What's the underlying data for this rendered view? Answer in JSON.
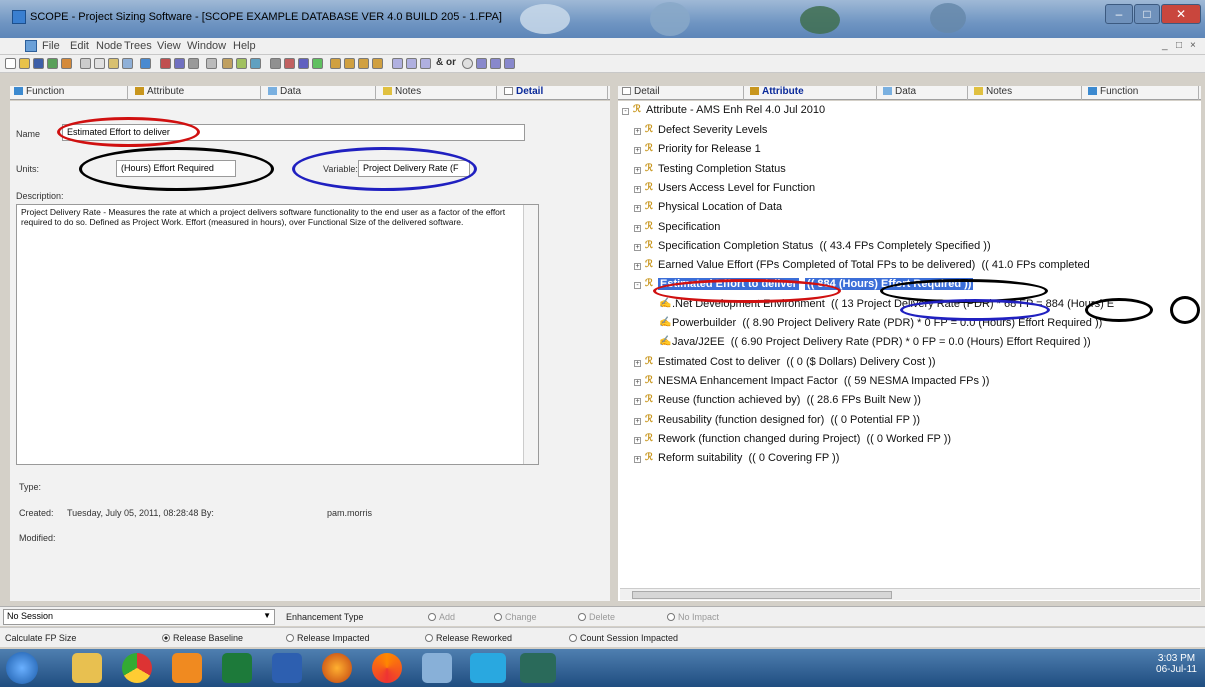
{
  "window": {
    "title": "SCOPE - Project Sizing Software - [SCOPE EXAMPLE DATABASE VER 4.0 BUILD 205 - 1.FPA]"
  },
  "menu": [
    "File",
    "Edit",
    "Node",
    "Trees",
    "View",
    "Window",
    "Help"
  ],
  "toolbar_text": [
    "& or",
    "&"
  ],
  "left_tabs": [
    "Function",
    "Attribute",
    "Data",
    "Notes",
    "Detail"
  ],
  "right_tabs": [
    "Detail",
    "Attribute",
    "Data",
    "Notes",
    "Function"
  ],
  "detail": {
    "name_label": "Name",
    "name_value": "Estimated Effort to deliver",
    "units_label": "Units:",
    "units_value": "(Hours) Effort Required",
    "variable_label": "Variable:",
    "variable_value": "Project Delivery Rate (F",
    "description_label": "Description:",
    "description_value": "Project Delivery Rate - Measures the rate at which a project delivers software functionality to the end user as a factor of the effort required to do so. Defined as Project Work. Effort (measured in hours), over Functional Size of the delivered software.",
    "type_label": "Type:",
    "created_label": "Created:",
    "created_value": "Tuesday, July 05, 2011, 08:28:48 By:",
    "created_by": "pam.morris",
    "modified_label": "Modified:"
  },
  "tree": {
    "root": "Attribute - AMS Enh Rel 4.0 Jul 2010",
    "items": [
      {
        "label": "Defect Severity Levels",
        "value": ""
      },
      {
        "label": "Priority for Release 1",
        "value": ""
      },
      {
        "label": "Testing Completion Status",
        "value": ""
      },
      {
        "label": "Users Access Level for Function",
        "value": ""
      },
      {
        "label": "Physical Location of Data",
        "value": ""
      },
      {
        "label": "Specification",
        "value": ""
      },
      {
        "label": "Specification Completion Status",
        "value": "(( 43.4  FPs Completely Specified ))"
      },
      {
        "label": "Earned Value Effort  (FPs Completed of Total FPs to be delivered)",
        "value": "(( 41.0  FPs completed"
      },
      {
        "label": "Estimated Effort to deliver",
        "value": "(( 884  (Hours)  Effort Required ))"
      },
      {
        "label": ".Net Development Environment",
        "value": "(( 13 Project Delivery Rate (PDR) * 68 FP = 884 (Hours)  E"
      },
      {
        "label": "Powerbuilder",
        "value": "(( 8.90 Project Delivery Rate (PDR) * 0 FP = 0.0 (Hours)  Effort Required ))"
      },
      {
        "label": "Java/J2EE",
        "value": "(( 6.90 Project Delivery Rate (PDR) * 0 FP = 0.0 (Hours)  Effort Required ))"
      },
      {
        "label": "Estimated Cost to deliver",
        "value": "(( 0  ($ Dollars) Delivery Cost ))"
      },
      {
        "label": "NESMA Enhancement Impact Factor",
        "value": "(( 59  NESMA Impacted FPs ))"
      },
      {
        "label": "Reuse (function achieved by)",
        "value": "(( 28.6  FPs Built New ))"
      },
      {
        "label": "Reusability (function designed for)",
        "value": "(( 0  Potential FP ))"
      },
      {
        "label": "Rework (function changed during Project)",
        "value": "(( 0  Worked FP ))"
      },
      {
        "label": "Reform suitability",
        "value": "(( 0  Covering FP ))"
      }
    ]
  },
  "status": {
    "session": "No Session",
    "enhancement_type_label": "Enhancement Type",
    "enh_options": [
      "Add",
      "Change",
      "Delete",
      "No Impact"
    ],
    "calc_label": "Calculate FP Size",
    "calc_options": [
      "Release Baseline",
      "Release Impacted",
      "Release Reworked",
      "Count Session Impacted"
    ]
  },
  "clock": {
    "time": "3:03 PM",
    "date": "06-Jul-11"
  },
  "colors": {
    "highlight": "#3b6ed8",
    "red_ring": "#d01010",
    "blue_ring": "#2020c0",
    "black_ring": "#000000"
  }
}
